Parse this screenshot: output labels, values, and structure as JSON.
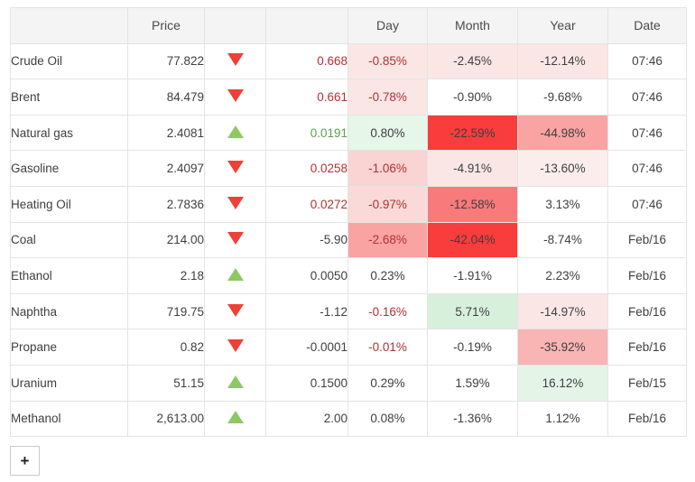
{
  "table": {
    "headers": {
      "name": "",
      "price": "Price",
      "arrow": "",
      "change": "",
      "day": "Day",
      "month": "Month",
      "year": "Year",
      "date": "Date"
    },
    "rows": [
      {
        "name": "Crude Oil",
        "price": "77.822",
        "direction": "down",
        "change": "0.668",
        "change_color": "down",
        "day": "-0.85%",
        "day_bg": "#fbe6e6",
        "month": "-2.45%",
        "month_bg": "#fbe6e6",
        "year": "-12.14%",
        "year_bg": "#fbe6e6",
        "date": "07:46"
      },
      {
        "name": "Brent",
        "price": "84.479",
        "direction": "down",
        "change": "0.661",
        "change_color": "down",
        "day": "-0.78%",
        "day_bg": "#fbe6e6",
        "month": "-0.90%",
        "month_bg": "#ffffff",
        "year": "-9.68%",
        "year_bg": "#ffffff",
        "date": "07:46"
      },
      {
        "name": "Natural gas",
        "price": "2.4081",
        "direction": "up",
        "change": "0.0191",
        "change_color": "up",
        "day": "0.80%",
        "day_bg": "#e6f6e9",
        "month": "-22.59%",
        "month_bg": "#f93c3c",
        "year": "-44.98%",
        "year_bg": "#f9a3a3",
        "date": "07:46"
      },
      {
        "name": "Gasoline",
        "price": "2.4097",
        "direction": "down",
        "change": "0.0258",
        "change_color": "down",
        "day": "-1.06%",
        "day_bg": "#fad3d3",
        "month": "-4.91%",
        "month_bg": "#fbe6e6",
        "year": "-13.60%",
        "year_bg": "#fceded",
        "date": "07:46"
      },
      {
        "name": "Heating Oil",
        "price": "2.7836",
        "direction": "down",
        "change": "0.0272",
        "change_color": "down",
        "day": "-0.97%",
        "day_bg": "#fad9d9",
        "month": "-12.58%",
        "month_bg": "#f87a7a",
        "year": "3.13%",
        "year_bg": "#ffffff",
        "date": "07:46"
      },
      {
        "name": "Coal",
        "price": "214.00",
        "direction": "down",
        "change": "-5.90",
        "change_color": "flat",
        "day": "-2.68%",
        "day_bg": "#f9a3a3",
        "month": "-42.04%",
        "month_bg": "#f93c3c",
        "year": "-8.74%",
        "year_bg": "#ffffff",
        "date": "Feb/16"
      },
      {
        "name": "Ethanol",
        "price": "2.18",
        "direction": "up",
        "change": "0.0050",
        "change_color": "flat",
        "day": "0.23%",
        "day_bg": "#ffffff",
        "month": "-1.91%",
        "month_bg": "#ffffff",
        "year": "2.23%",
        "year_bg": "#ffffff",
        "date": "Feb/16"
      },
      {
        "name": "Naphtha",
        "price": "719.75",
        "direction": "down",
        "change": "-1.12",
        "change_color": "flat",
        "day": "-0.16%",
        "day_bg": "#ffffff",
        "month": "5.71%",
        "month_bg": "#d6f0dc",
        "year": "-14.97%",
        "year_bg": "#fbe6e6",
        "date": "Feb/16"
      },
      {
        "name": "Propane",
        "price": "0.82",
        "direction": "down",
        "change": "-0.0001",
        "change_color": "flat",
        "day": "-0.01%",
        "day_bg": "#ffffff",
        "month": "-0.19%",
        "month_bg": "#ffffff",
        "year": "-35.92%",
        "year_bg": "#f9b4b4",
        "date": "Feb/16"
      },
      {
        "name": "Uranium",
        "price": "51.15",
        "direction": "up",
        "change": "0.1500",
        "change_color": "flat",
        "day": "0.29%",
        "day_bg": "#ffffff",
        "month": "1.59%",
        "month_bg": "#ffffff",
        "year": "16.12%",
        "year_bg": "#e4f5e8",
        "date": "Feb/15"
      },
      {
        "name": "Methanol",
        "price": "2,613.00",
        "direction": "up",
        "change": "2.00",
        "change_color": "flat",
        "day": "0.08%",
        "day_bg": "#ffffff",
        "month": "-1.36%",
        "month_bg": "#ffffff",
        "year": "1.12%",
        "year_bg": "#ffffff",
        "date": "Feb/16"
      }
    ]
  },
  "controls": {
    "add_row_label": "+"
  }
}
